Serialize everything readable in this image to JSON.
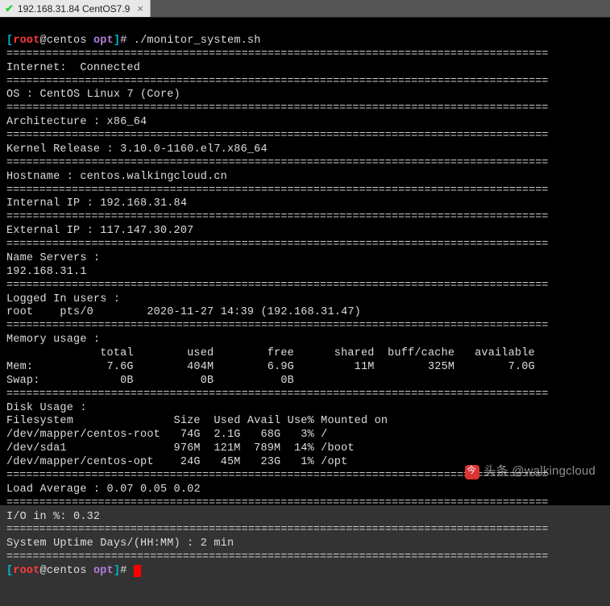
{
  "tab": {
    "title": "192.168.31.84 CentOS7.9"
  },
  "prompt1": {
    "user": "root",
    "host": "centos",
    "dir": "opt",
    "cmd": "./monitor_system.sh"
  },
  "sep": "===================================================================================",
  "internet": {
    "label": "Internet:",
    "value": "Connected"
  },
  "os": {
    "label": "OS :",
    "value": "CentOS Linux 7 (Core)"
  },
  "arch": {
    "label": "Architecture :",
    "value": "x86_64"
  },
  "kernel": {
    "label": "Kernel Release :",
    "value": "3.10.0-1160.el7.x86_64"
  },
  "hostname": {
    "label": "Hostname :",
    "value": "centos.walkingcloud.cn"
  },
  "internal_ip": {
    "label": "Internal IP :",
    "value": "192.168.31.84"
  },
  "external_ip": {
    "label": "External IP :",
    "value": "117.147.30.207"
  },
  "nameservers": {
    "label": "Name Servers :",
    "value": "192.168.31.1"
  },
  "logged_users": {
    "label": "Logged In users :",
    "row": "root    pts/0        2020-11-27 14:39 (192.168.31.47)"
  },
  "mem": {
    "label": "Memory usage :",
    "header": "              total        used        free      shared  buff/cache   available",
    "rows": [
      "Mem:           7.6G        404M        6.9G         11M        325M        7.0G",
      "Swap:            0B          0B          0B"
    ]
  },
  "disk": {
    "label": "Disk Usage :",
    "header": "Filesystem               Size  Used Avail Use% Mounted on",
    "rows": [
      "/dev/mapper/centos-root   74G  2.1G   68G   3% /",
      "/dev/sda1                976M  121M  789M  14% /boot",
      "/dev/mapper/centos-opt    24G   45M   23G   1% /opt"
    ]
  },
  "load": {
    "label": "Load Average :",
    "value": "0.07 0.05 0.02"
  },
  "io": {
    "label": "I/O in %:",
    "value": "0.32"
  },
  "uptime": {
    "label": "System Uptime Days/(HH:MM) :",
    "value": "2 min"
  },
  "prompt2": {
    "user": "root",
    "host": "centos",
    "dir": "opt"
  },
  "watermark": "头条 @walkingcloud"
}
